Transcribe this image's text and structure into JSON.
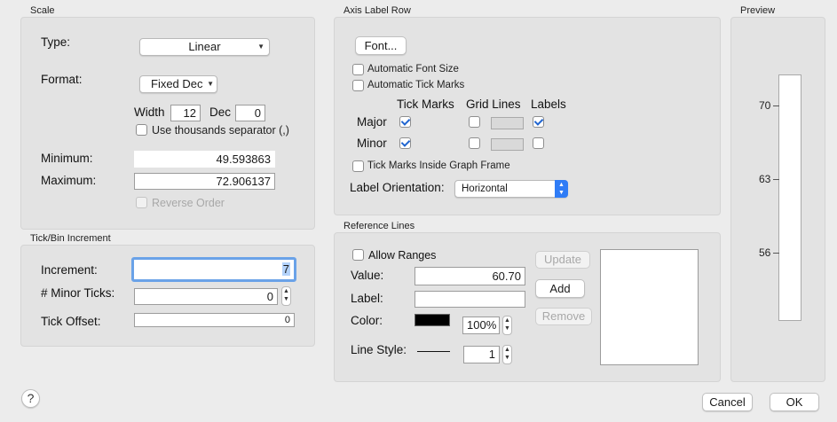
{
  "scale": {
    "title": "Scale",
    "type_label": "Type:",
    "type_value": "Linear",
    "format_label": "Format:",
    "format_value": "Fixed Dec",
    "width_label": "Width",
    "width_value": "12",
    "dec_label": "Dec",
    "dec_value": "0",
    "thousands_label": "Use thousands separator (,)",
    "thousands_checked": false,
    "minimum_label": "Minimum:",
    "minimum_value": "49.593863",
    "maximum_label": "Maximum:",
    "maximum_value": "72.906137",
    "reverse_label": "Reverse Order",
    "reverse_checked": false
  },
  "tick_bin": {
    "title": "Tick/Bin Increment",
    "increment_label": "Increment:",
    "increment_value": "7",
    "minor_ticks_label": "# Minor Ticks:",
    "minor_ticks_value": "0",
    "tick_offset_label": "Tick Offset:",
    "tick_offset_value": "0"
  },
  "axis_label_row": {
    "title": "Axis Label Row",
    "font_button": "Font...",
    "auto_font_size_label": "Automatic Font Size",
    "auto_font_size_checked": false,
    "auto_tick_marks_label": "Automatic Tick Marks",
    "auto_tick_marks_checked": false,
    "columns": [
      "Tick Marks",
      "Grid Lines",
      "Labels"
    ],
    "rows": [
      {
        "label": "Major",
        "tick_marks": true,
        "grid_lines": false,
        "labels": true
      },
      {
        "label": "Minor",
        "tick_marks": true,
        "grid_lines": false,
        "labels": false
      }
    ],
    "inside_frame_label": "Tick Marks Inside Graph Frame",
    "inside_frame_checked": false,
    "orientation_label": "Label Orientation:",
    "orientation_value": "Horizontal"
  },
  "reference_lines": {
    "title": "Reference Lines",
    "allow_ranges_label": "Allow Ranges",
    "allow_ranges_checked": false,
    "value_label": "Value:",
    "value_value": "60.70",
    "label_label": "Label:",
    "label_value": "",
    "color_label": "Color:",
    "color_hex": "#000000",
    "opacity_value": "100%",
    "line_style_label": "Line Style:",
    "line_width_value": "1",
    "update_button": "Update",
    "add_button": "Add",
    "remove_button": "Remove"
  },
  "preview": {
    "title": "Preview",
    "ticks": [
      "70",
      "63",
      "56"
    ]
  },
  "footer": {
    "help_label": "?",
    "cancel_button": "Cancel",
    "ok_button": "OK"
  },
  "colors": {
    "check_accent": "#2065d0",
    "focus_ring": "#6aa2e8",
    "dialog_bg": "#ececec"
  }
}
